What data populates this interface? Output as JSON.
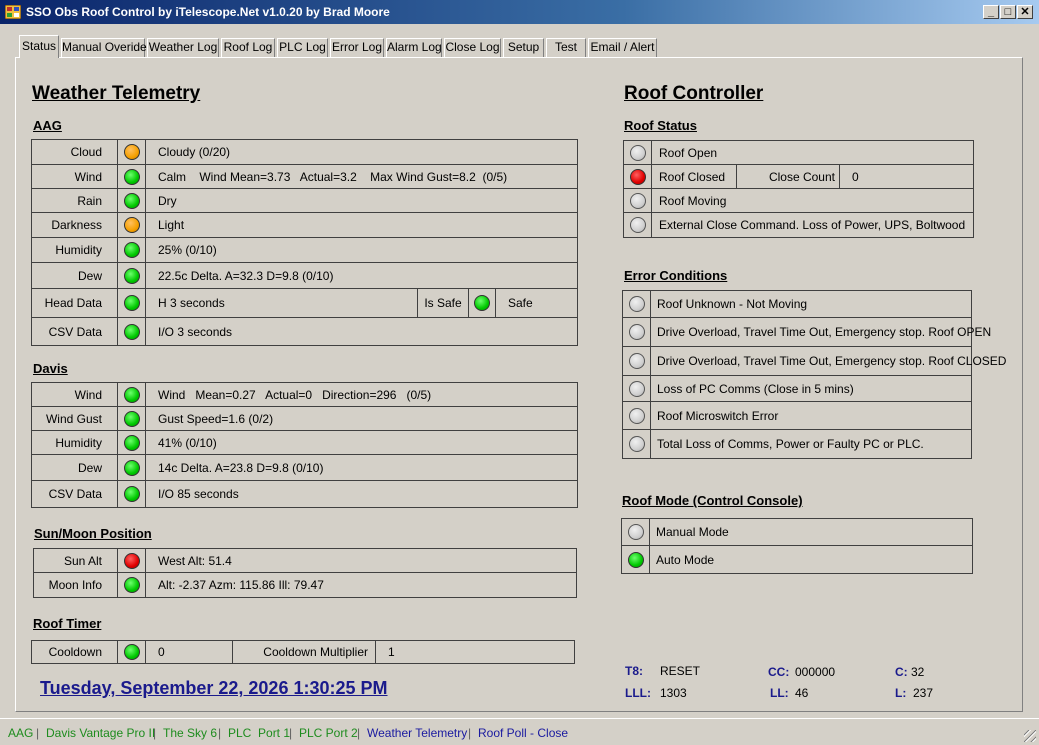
{
  "window": {
    "title": "SSO Obs Roof Control by iTelescope.Net v1.0.20 by Brad Moore"
  },
  "tabs": [
    "Status",
    "Manual Overide",
    "Weather Log",
    "Roof Log",
    "PLC Log",
    "Error Log",
    "Alarm Log",
    "Close Log",
    "Setup",
    "Test",
    "Email / Alert"
  ],
  "weather": {
    "title": "Weather Telemetry",
    "aag": {
      "heading": "AAG",
      "rows": [
        {
          "label": "Cloud",
          "led": "orange",
          "value": "Cloudy  (0/20)"
        },
        {
          "label": "Wind",
          "led": "green",
          "value": "Calm    Wind Mean=3.73   Actual=3.2    Max Wind Gust=8.2  (0/5)"
        },
        {
          "label": "Rain",
          "led": "green",
          "value": "Dry"
        },
        {
          "label": "Darkness",
          "led": "orange",
          "value": "Light"
        },
        {
          "label": "Humidity",
          "led": "green",
          "value": "25%  (0/10)"
        },
        {
          "label": "Dew",
          "led": "green",
          "value": "22.5c Delta. A=32.3 D=9.8  (0/10)"
        },
        {
          "label": "Head Data",
          "led": "green",
          "value": "H 3 seconds",
          "extra_label": "Is Safe",
          "extra_led": "green",
          "extra_value": "Safe"
        },
        {
          "label": "CSV Data",
          "led": "green",
          "value": "I/O 3 seconds"
        }
      ]
    },
    "davis": {
      "heading": "Davis",
      "rows": [
        {
          "label": "Wind",
          "led": "green",
          "value": "Wind   Mean=0.27   Actual=0   Direction=296   (0/5)"
        },
        {
          "label": "Wind Gust",
          "led": "green",
          "value": "Gust Speed=1.6  (0/2)"
        },
        {
          "label": "Humidity",
          "led": "green",
          "value": "41%  (0/10)"
        },
        {
          "label": "Dew",
          "led": "green",
          "value": "14c Delta. A=23.8 D=9.8  (0/10)"
        },
        {
          "label": "CSV Data",
          "led": "green",
          "value": "I/O 85 seconds"
        }
      ]
    },
    "sunmoon": {
      "heading": "Sun/Moon Position",
      "rows": [
        {
          "label": "Sun Alt",
          "led": "red",
          "value": "West Alt: 51.4"
        },
        {
          "label": "Moon Info",
          "led": "green",
          "value": "Alt: -2.37  Azm: 115.86  Ill: 79.47"
        }
      ]
    },
    "timer": {
      "heading": "Roof Timer",
      "label": "Cooldown",
      "led": "green",
      "value": "0",
      "mult_label": "Cooldown Multiplier",
      "mult_value": "1"
    },
    "datetime": "Tuesday, September 22, 2026 1:30:25 PM"
  },
  "roof": {
    "title": "Roof Controller",
    "status": {
      "heading": "Roof Status",
      "rows": [
        {
          "led": "off",
          "label": "Roof Open"
        },
        {
          "led": "red",
          "label": "Roof Closed",
          "extra_label": "Close Count",
          "extra_value": "0"
        },
        {
          "led": "off",
          "label": "Roof Moving"
        },
        {
          "led": "off",
          "label": "External Close Command. Loss of Power, UPS, Boltwood"
        }
      ]
    },
    "errors": {
      "heading": "Error Conditions",
      "rows": [
        {
          "led": "off",
          "label": "Roof Unknown - Not Moving"
        },
        {
          "led": "off",
          "label": "Drive Overload, Travel Time Out, Emergency stop. Roof OPEN"
        },
        {
          "led": "off",
          "label": "Drive Overload, Travel Time Out, Emergency stop. Roof CLOSED"
        },
        {
          "led": "off",
          "label": "Loss of PC Comms (Close in 5 mins)"
        },
        {
          "led": "off",
          "label": "Roof Microswitch Error"
        },
        {
          "led": "off",
          "label": "Total Loss of Comms, Power or Faulty PC or PLC."
        }
      ]
    },
    "mode": {
      "heading": "Roof Mode (Control Console)",
      "rows": [
        {
          "led": "off",
          "label": "Manual Mode"
        },
        {
          "led": "green",
          "label": "Auto Mode"
        }
      ]
    },
    "stats": {
      "t8_label": "T8:",
      "t8_value": "RESET",
      "cc_label": "CC:",
      "cc_value": "000000",
      "c_label": "C:",
      "c_value": "32",
      "lll_label": "LLL:",
      "lll_value": "1303",
      "ll_label": "LL:",
      "ll_value": "46",
      "l_label": "L:",
      "l_value": "237"
    }
  },
  "statusbar": [
    {
      "text": "AAG",
      "color": "green"
    },
    {
      "text": "Davis Vantage Pro II",
      "color": "green"
    },
    {
      "text": "The Sky 6",
      "color": "green"
    },
    {
      "text": "PLC  Port 1",
      "color": "green"
    },
    {
      "text": "PLC Port 2",
      "color": "green"
    },
    {
      "text": "Weather Telemetry",
      "color": "blue"
    },
    {
      "text": "Roof Poll - Close",
      "color": "blue"
    }
  ]
}
